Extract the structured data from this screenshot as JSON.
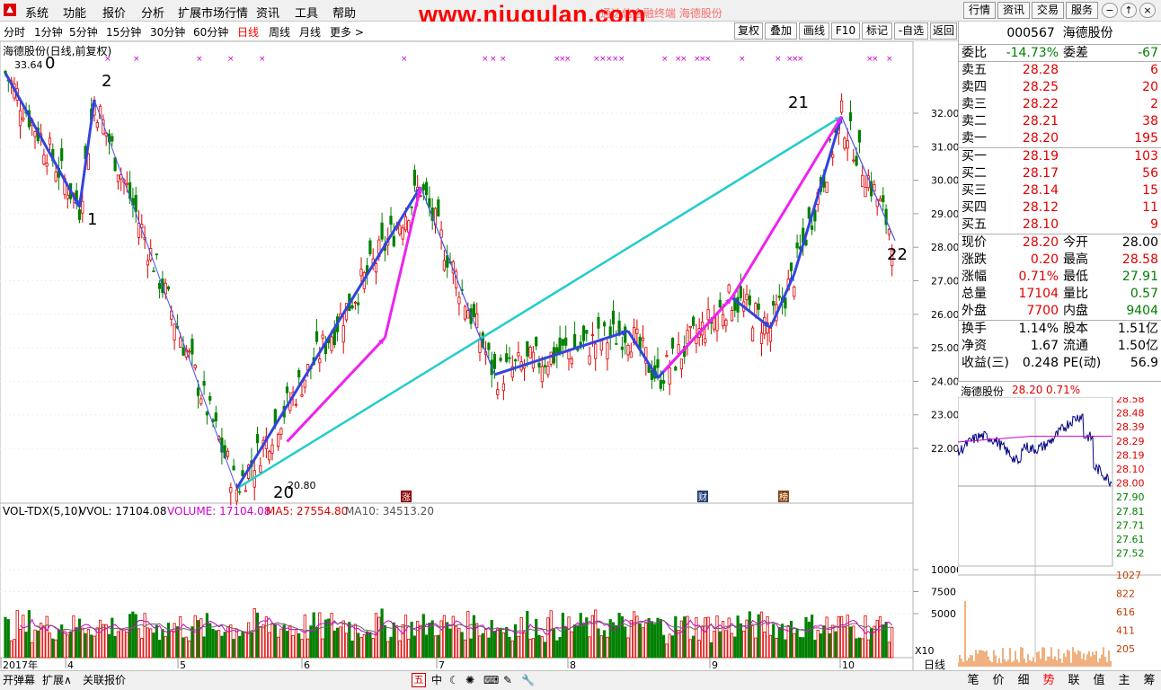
{
  "menu": [
    "系统",
    "功能",
    "报价",
    "分析",
    "扩展市场行情",
    "资讯",
    "工具",
    "帮助"
  ],
  "watermark": "www.niugulan.com",
  "watermark_sub": "通达信金融终端  海德股份",
  "top_buttons": [
    "行情",
    "资讯",
    "交易",
    "服务"
  ],
  "window_buttons": [
    "−",
    "↑",
    "×"
  ],
  "periods": [
    "分时",
    "1分钟",
    "5分钟",
    "15分钟",
    "30分钟",
    "60分钟",
    "日线",
    "周线",
    "月线",
    "更多 >"
  ],
  "active_period": "日线",
  "chart_tools": [
    "复权",
    "叠加",
    "画线",
    "F10",
    "标记",
    "-自选",
    "返回"
  ],
  "main_title": "海德股份(日线,前复权)",
  "price_axis": [
    "32.00",
    "31.00",
    "30.00",
    "29.00",
    "28.00",
    "27.00",
    "26.00",
    "25.00",
    "24.00",
    "23.00",
    "22.00"
  ],
  "annotations": {
    "high": "33.64",
    "low": "20.80",
    "wave_labels": [
      "0",
      "1",
      "2",
      "20",
      "21",
      "22"
    ]
  },
  "event_icons": [
    "涨",
    "财",
    "榜"
  ],
  "volume_title": {
    "name": "VOL-TDX(5,10)",
    "vvol": "VVOL: 17104.08",
    "volume": "VOLUME: 17104.08",
    "ma5": "MA5: 27554.80",
    "ma10": "MA10: 34513.20"
  },
  "volume_axis": [
    "10000",
    "7500",
    "5000"
  ],
  "volume_unit": "X10",
  "date_axis": [
    "2017年",
    "4",
    "5",
    "6",
    "7",
    "8",
    "9",
    "10"
  ],
  "date_period_label": "日线",
  "quote": {
    "code": "000567",
    "name": "海德股份",
    "weibi_label": "委比",
    "weibi": "-14.73%",
    "weicha_label": "委差",
    "weicha": "-67",
    "asks": [
      {
        "label": "卖五",
        "price": "28.28",
        "vol": "6"
      },
      {
        "label": "卖四",
        "price": "28.25",
        "vol": "20"
      },
      {
        "label": "卖三",
        "price": "28.22",
        "vol": "2"
      },
      {
        "label": "卖二",
        "price": "28.21",
        "vol": "38"
      },
      {
        "label": "卖一",
        "price": "28.20",
        "vol": "195"
      }
    ],
    "bids": [
      {
        "label": "买一",
        "price": "28.19",
        "vol": "103"
      },
      {
        "label": "买二",
        "price": "28.17",
        "vol": "56"
      },
      {
        "label": "买三",
        "price": "28.14",
        "vol": "15"
      },
      {
        "label": "买四",
        "price": "28.12",
        "vol": "11"
      },
      {
        "label": "买五",
        "price": "28.10",
        "vol": "9"
      }
    ],
    "stats": [
      {
        "l1": "现价",
        "v1": "28.20",
        "l2": "今开",
        "v2": "28.00"
      },
      {
        "l1": "涨跌",
        "v1": "0.20",
        "l2": "最高",
        "v2": "28.58"
      },
      {
        "l1": "涨幅",
        "v1": "0.71%",
        "l2": "最低",
        "v2": "27.91"
      },
      {
        "l1": "总量",
        "v1": "17104",
        "l2": "量比",
        "v2": "0.57"
      },
      {
        "l1": "外盘",
        "v1": "7700",
        "l2": "内盘",
        "v2": "9404"
      }
    ],
    "stats2": [
      {
        "l1": "换手",
        "v1": "1.14%",
        "l2": "股本",
        "v2": "1.51亿"
      },
      {
        "l1": "净资",
        "v1": "1.67",
        "l2": "流通",
        "v2": "1.50亿"
      },
      {
        "l1": "收益(三)",
        "v1": "0.248",
        "l2": "PE(动)",
        "v2": "56.9"
      }
    ]
  },
  "mini_chart": {
    "name": "海德股份",
    "price": "28.20",
    "pct": "0.71%",
    "price_axis": [
      "28.58",
      "28.48",
      "28.39",
      "28.29",
      "28.19",
      "28.10",
      "28.00",
      "27.90",
      "27.81",
      "27.71",
      "27.61",
      "27.52"
    ],
    "vol_axis": [
      "1027",
      "822",
      "616",
      "411",
      "205"
    ]
  },
  "bottom_buttons": [
    "开弹幕",
    "扩展∧",
    "关联报价"
  ],
  "bottom_icons": [
    "五",
    "中",
    "moon-icon",
    "swirl-icon",
    "chart-icon",
    "keyboard-icon",
    "pen-icon",
    "wrench-icon"
  ],
  "right_tabs": [
    "笔",
    "价",
    "细",
    "势",
    "联",
    "值",
    "主",
    "筹"
  ],
  "active_tab": "势",
  "colors": {
    "up": "#e00000",
    "down": "#008000",
    "wave_blue": "#3344dd",
    "magenta": "#ee22ee",
    "cyan": "#22cccc"
  }
}
